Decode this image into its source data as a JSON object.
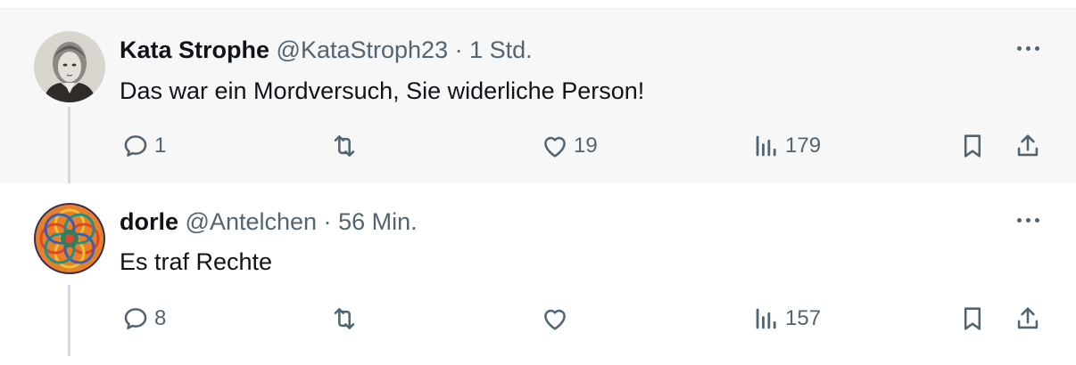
{
  "tweets": [
    {
      "author_name": "Kata Strophe",
      "handle": "@KataStroph23",
      "separator": "·",
      "time": "1 Std.",
      "text": "Das war ein Mordversuch, Sie widerliche Person!",
      "reply_count": "1",
      "retweet_count": "",
      "like_count": "19",
      "view_count": "179",
      "avatar_icon": "portrait-avatar"
    },
    {
      "author_name": "dorle",
      "handle": "@Antelchen",
      "separator": "·",
      "time": "56 Min.",
      "text": "Es traf Rechte",
      "reply_count": "8",
      "retweet_count": "",
      "like_count": "",
      "view_count": "157",
      "avatar_icon": "mandala-avatar"
    }
  ],
  "icons": {
    "reply": "reply-icon",
    "retweet": "retweet-icon",
    "like": "heart-icon",
    "views": "views-icon",
    "bookmark": "bookmark-icon",
    "share": "share-icon",
    "more": "more-icon"
  },
  "colors": {
    "text": "#0f1419",
    "secondary": "#536471",
    "thread_line": "#cfd9de",
    "highlight_bg": "#f7f7f8"
  }
}
